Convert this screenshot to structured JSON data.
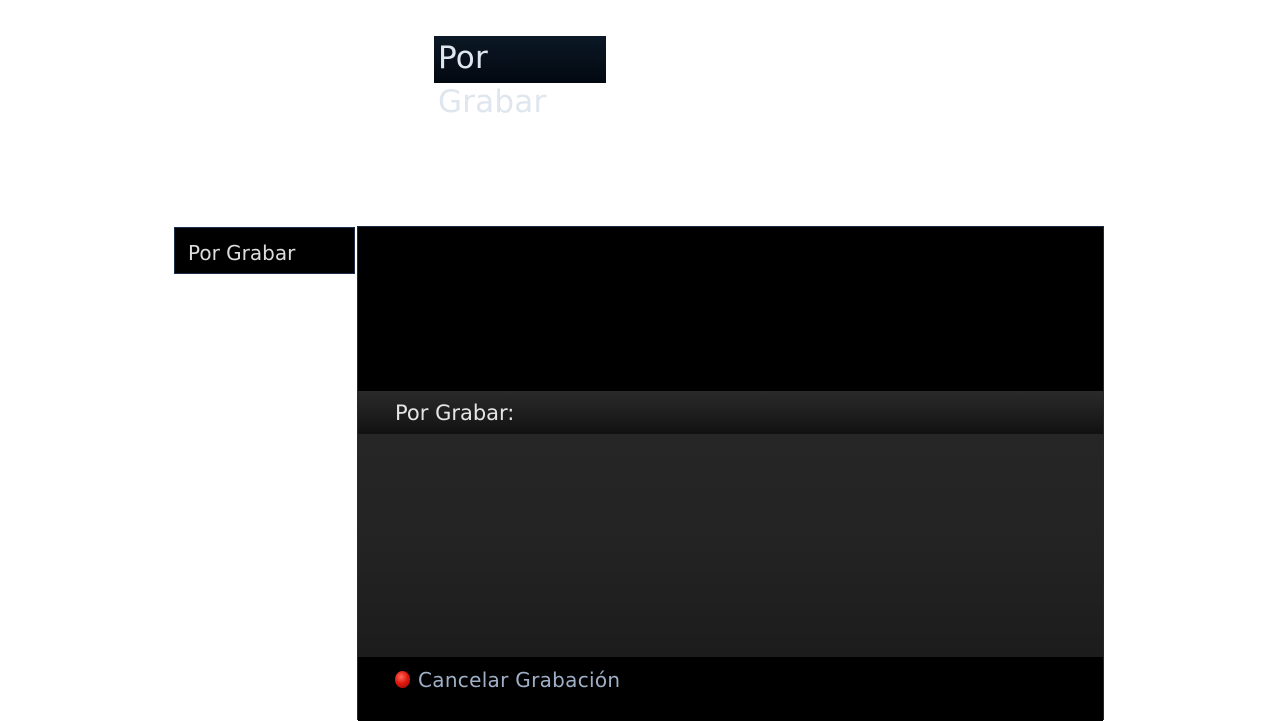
{
  "header": {
    "title": "Por Grabar"
  },
  "sidebar": {
    "tab_label": "Por Grabar"
  },
  "panel": {
    "section_label": "Por Grabar:",
    "footer": {
      "action_label": "Cancelar Grabación",
      "action_icon": "red-button-icon",
      "action_color": "#e01a10"
    }
  },
  "colors": {
    "panel_background": "#000000",
    "body_background": "#232323",
    "label_text": "#e4e4e4",
    "action_text": "#9fb0c6",
    "border": "#1a2a44"
  }
}
